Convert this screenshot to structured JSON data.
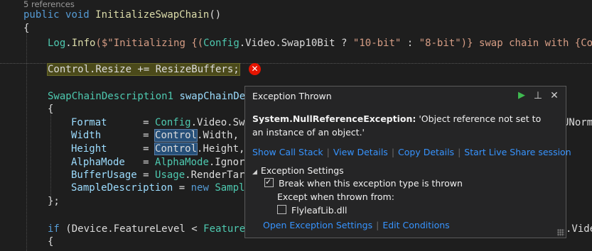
{
  "code": {
    "references": "5 references",
    "line_sig": {
      "kw1": "public",
      "kw2": "void",
      "fn": "InitializeSwapChain",
      "rest": "()"
    },
    "line_open1": "{",
    "line_log": {
      "ty": "Log",
      "dot": ".",
      "fn": "Info",
      "a": "($\"Initializing {(",
      "ty2": "Config",
      "b": ".Video.Swap10Bit ? ",
      "s1": "\"10-bit\"",
      "c": " : ",
      "s2": "\"8-bit\"",
      "d": ")} swap chain with {Conf"
    },
    "line_resize": "Control.Resize += ResizeBuffers;",
    "line_desc": {
      "ty": "SwapChainDescription1",
      "id": "swapChainDe"
    },
    "line_open2": "{",
    "line_format": {
      "id": "Format",
      "eq": "      = ",
      "ty": "Config",
      "rest": ".Video.Sw",
      "tail": "UNorm,"
    },
    "line_width": {
      "id": "Width",
      "eq": "       = ",
      "ref": "Control",
      "rest": ".Width,"
    },
    "line_height": {
      "id": "Height",
      "eq": "      = ",
      "ref": "Control",
      "rest": ".Height,"
    },
    "line_alpha": {
      "id": "AlphaMode",
      "eq": "   = ",
      "ty": "AlphaMode",
      "rest": ".Ignor"
    },
    "line_buffer": {
      "id": "BufferUsage",
      "eq": " = ",
      "ty": "Usage",
      "rest": ".RenderTar"
    },
    "line_sample": {
      "id": "SampleDescription",
      "eq": " = ",
      "kw": "new",
      "ty": "Sampl"
    },
    "line_close": "};",
    "line_if": {
      "kw": "if",
      "a": " (Device.FeatureLevel < ",
      "ty": "Feature",
      "tail": ".Vide"
    },
    "line_open3": "{"
  },
  "error_icon": {
    "glyph": "✕",
    "color": "#e51400"
  },
  "popup": {
    "title": "Exception Thrown",
    "continue_icon": "▶",
    "pin_icon": "⊥",
    "close_icon": "✕",
    "exception_type": "System.NullReferenceException:",
    "message": " 'Object reference not set to an instance of an object.'",
    "links": [
      "Show Call Stack",
      "View Details",
      "Copy Details",
      "Start Live Share session"
    ],
    "settings_title": "Exception Settings",
    "break_label": "Break when this exception type is thrown",
    "break_checked": true,
    "except_label": "Except when thrown from:",
    "module_label": "FlyleafLib.dll",
    "module_checked": false,
    "footer_links": [
      "Open Exception Settings",
      "Edit Conditions"
    ]
  }
}
